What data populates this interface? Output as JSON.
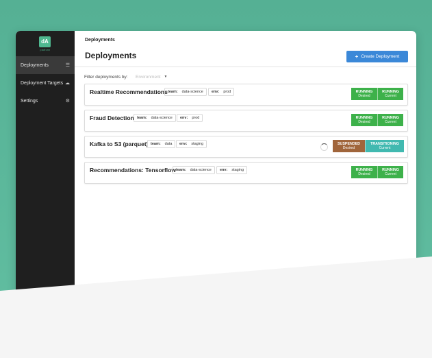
{
  "logo": {
    "mark": "dA",
    "sub": "platform"
  },
  "sidebar": {
    "items": [
      {
        "label": "Deployments",
        "icon": "list-icon"
      },
      {
        "label": "Deployment Targets",
        "icon": "cloud-upload-icon"
      },
      {
        "label": "Settings",
        "icon": "gears-icon"
      }
    ]
  },
  "header": {
    "breadcrumb": "Deployments",
    "title": "Deployments",
    "create_label": "Create Deployment"
  },
  "filter": {
    "label": "Filter deployments by:",
    "placeholder": "Environment"
  },
  "deployments": [
    {
      "name": "Realtime Recommendations",
      "tags": [
        {
          "key": "team:",
          "value": "data-science"
        },
        {
          "key": "env:",
          "value": "prod"
        }
      ],
      "desired": {
        "state": "RUNNING",
        "label": "Desired"
      },
      "current": {
        "state": "RUNNING",
        "label": "Current"
      }
    },
    {
      "name": "Fraud Detection",
      "tags": [
        {
          "key": "team:",
          "value": "data-science"
        },
        {
          "key": "env:",
          "value": "prod"
        }
      ],
      "desired": {
        "state": "RUNNING",
        "label": "Desired"
      },
      "current": {
        "state": "RUNNING",
        "label": "Current"
      }
    },
    {
      "name": "Kafka to S3 (parquet)",
      "tags": [
        {
          "key": "team:",
          "value": "data"
        },
        {
          "key": "env:",
          "value": "staging"
        }
      ],
      "desired": {
        "state": "SUSPENDED",
        "label": "Desired"
      },
      "current": {
        "state": "TRANSITIONING",
        "label": "Current"
      }
    },
    {
      "name": "Recommendations: Tensorflow",
      "tags": [
        {
          "key": "team:",
          "value": "data-science"
        },
        {
          "key": "env:",
          "value": "staging"
        }
      ],
      "desired": {
        "state": "RUNNING",
        "label": "Desired"
      },
      "current": {
        "state": "RUNNING",
        "label": "Current"
      }
    }
  ],
  "colors": {
    "accent": "#3b88d8",
    "running": "#3db14a",
    "suspended": "#a0653b",
    "transitioning": "#41b9b0",
    "background": "#5bb89b"
  }
}
